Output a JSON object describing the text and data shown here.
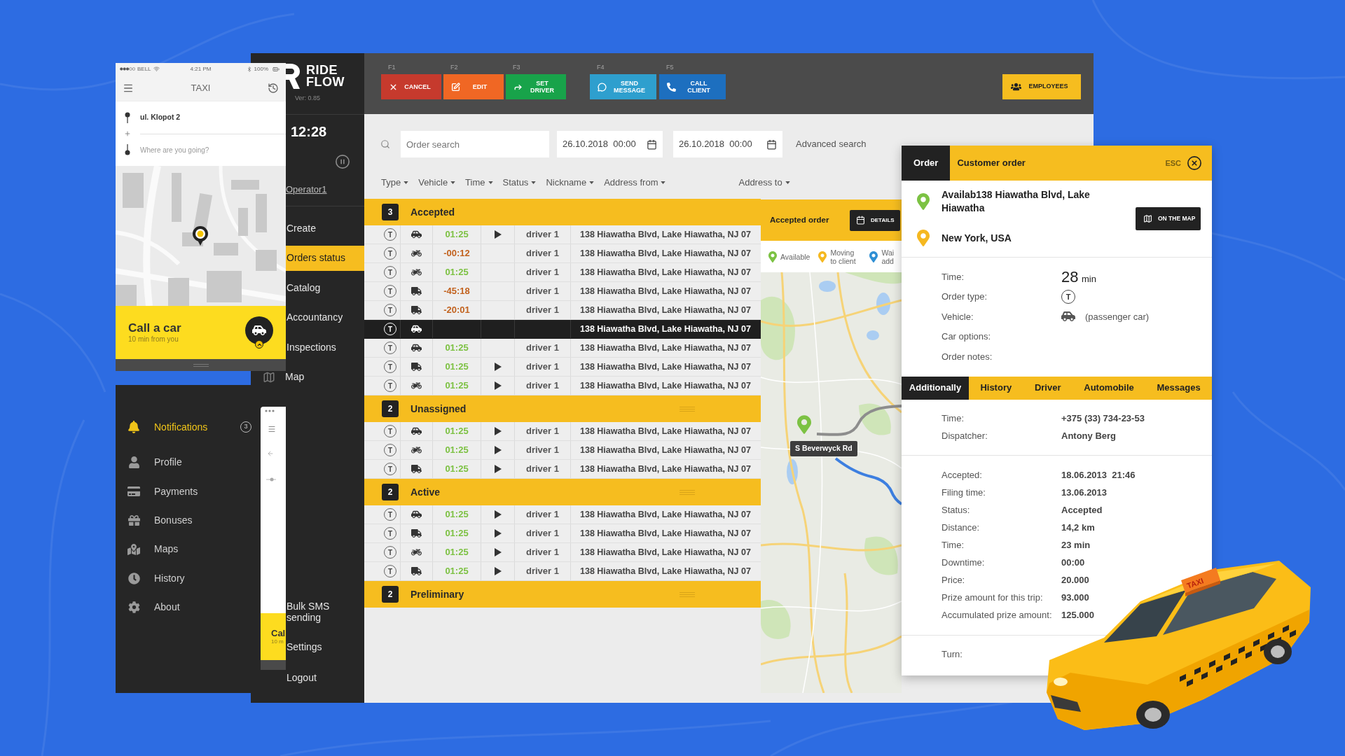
{
  "phone": {
    "status_bar": {
      "carrier": "BELL",
      "time": "4:21 PM",
      "battery": "100%"
    },
    "title": "TAXI",
    "pickup": "ul. Klopot 2",
    "destination": {
      "placeholder": "Where are you going?"
    },
    "call_panel": {
      "title": "Call a car",
      "subtitle": "10 min from you"
    }
  },
  "phone_menu": {
    "items": [
      {
        "label": "Notifications",
        "selected": true,
        "badge": "3"
      },
      {
        "label": "Profile",
        "selected": false
      },
      {
        "label": "Payments",
        "selected": false
      },
      {
        "label": "Bonuses",
        "selected": false
      },
      {
        "label": "Maps",
        "selected": false
      },
      {
        "label": "History",
        "selected": false
      },
      {
        "label": "About",
        "selected": false
      }
    ],
    "peek": {
      "title": "Cal",
      "subtitle": "10 m"
    }
  },
  "sidebar": {
    "logo": [
      "RIDE",
      "FLOW"
    ],
    "version": "Ver: 0.85",
    "clock": "12:28",
    "operator": "Operator1",
    "nav": [
      {
        "label": "Create",
        "selected": false
      },
      {
        "label": "Orders status",
        "selected": true
      },
      {
        "label": "Catalog",
        "selected": false
      },
      {
        "label": "Accountancy",
        "selected": false
      },
      {
        "label": "Inspections",
        "selected": false
      },
      {
        "label": "Map",
        "selected": false
      }
    ],
    "nav_bottom": [
      {
        "label": "Bulk SMS sending",
        "selected": false
      },
      {
        "label": "Settings",
        "selected": false
      },
      {
        "label": "Logout",
        "selected": false
      }
    ]
  },
  "toolbar": {
    "button_groups": [
      [
        {
          "key": "F1",
          "label": "CANCEL",
          "color": "#c63a2d"
        },
        {
          "key": "F2",
          "label": "EDIT",
          "color": "#f06724"
        },
        {
          "key": "F3",
          "label": "SET DRIVER",
          "color": "#18a34a"
        }
      ],
      [
        {
          "key": "F4",
          "label": "SEND MESSAGE",
          "color": "#2e9fce"
        },
        {
          "key": "F5",
          "label": "CALL CLIENT",
          "color": "#1d6fbf"
        }
      ]
    ],
    "employees": "EMPLOYEES"
  },
  "search": {
    "query": {
      "placeholder": "Order search"
    },
    "date_from": "26.10.2018  00:00",
    "date_to": "26.10.2018  00:00",
    "advanced": "Advanced search"
  },
  "filters": [
    [
      "Type",
      "Vehicle",
      "Time",
      "Status",
      "Nickname",
      "Address from"
    ],
    [
      "Address to"
    ]
  ],
  "orders": {
    "groups": [
      {
        "title": "Accepted",
        "count": "3",
        "handle": false,
        "rows": [
          {
            "type": "T",
            "kind": "car",
            "time": "01:25",
            "late": false,
            "play": true,
            "driver": "driver 1",
            "address": "138 Hiawatha Blvd, Lake Hiawatha, NJ 07",
            "selected": false
          },
          {
            "type": "T",
            "kind": "moto",
            "time": "-00:12",
            "late": true,
            "play": false,
            "driver": "driver 1",
            "address": "138 Hiawatha Blvd, Lake Hiawatha, NJ 07",
            "selected": false
          },
          {
            "type": "T",
            "kind": "moto",
            "time": "01:25",
            "late": false,
            "play": false,
            "driver": "driver 1",
            "address": "138 Hiawatha Blvd, Lake Hiawatha, NJ 07",
            "selected": false
          },
          {
            "type": "T",
            "kind": "truck",
            "time": "-45:18",
            "late": true,
            "play": false,
            "driver": "driver 1",
            "address": "138 Hiawatha Blvd, Lake Hiawatha, NJ 07",
            "selected": false
          },
          {
            "type": "T",
            "kind": "truck",
            "time": "-20:01",
            "late": true,
            "play": false,
            "driver": "driver 1",
            "address": "138 Hiawatha Blvd, Lake Hiawatha, NJ 07",
            "selected": false
          },
          {
            "type": "T",
            "kind": "car",
            "play": false,
            "address": "138 Hiawatha Blvd, Lake Hiawatha, NJ 07",
            "selected": true
          },
          {
            "type": "T",
            "kind": "car",
            "time": "01:25",
            "late": false,
            "play": false,
            "driver": "driver 1",
            "address": "138 Hiawatha Blvd, Lake Hiawatha, NJ 07",
            "selected": false
          },
          {
            "type": "T",
            "kind": "truck",
            "time": "01:25",
            "late": false,
            "play": true,
            "driver": "driver 1",
            "address": "138 Hiawatha Blvd, Lake Hiawatha, NJ 07",
            "selected": false
          },
          {
            "type": "T",
            "kind": "moto",
            "time": "01:25",
            "late": false,
            "play": true,
            "driver": "driver 1",
            "address": "138 Hiawatha Blvd, Lake Hiawatha, NJ 07",
            "selected": false
          }
        ]
      },
      {
        "title": "Unassigned",
        "count": "2",
        "handle": true,
        "rows": [
          {
            "type": "T",
            "kind": "car",
            "time": "01:25",
            "late": false,
            "play": true,
            "driver": "driver 1",
            "address": "138 Hiawatha Blvd, Lake Hiawatha, NJ 07",
            "selected": false
          },
          {
            "type": "T",
            "kind": "moto",
            "time": "01:25",
            "late": false,
            "play": true,
            "driver": "driver 1",
            "address": "138 Hiawatha Blvd, Lake Hiawatha, NJ 07",
            "selected": false
          },
          {
            "type": "T",
            "kind": "truck",
            "time": "01:25",
            "late": false,
            "play": true,
            "driver": "driver 1",
            "address": "138 Hiawatha Blvd, Lake Hiawatha, NJ 07",
            "selected": false
          }
        ]
      },
      {
        "title": "Active",
        "count": "2",
        "handle": true,
        "rows": [
          {
            "type": "T",
            "kind": "car",
            "time": "01:25",
            "late": false,
            "play": true,
            "driver": "driver 1",
            "address": "138 Hiawatha Blvd, Lake Hiawatha, NJ 07",
            "selected": false
          },
          {
            "type": "T",
            "kind": "truck",
            "time": "01:25",
            "late": false,
            "play": true,
            "driver": "driver 1",
            "address": "138 Hiawatha Blvd, Lake Hiawatha, NJ 07",
            "selected": false
          },
          {
            "type": "T",
            "kind": "moto",
            "time": "01:25",
            "late": false,
            "play": true,
            "driver": "driver 1",
            "address": "138 Hiawatha Blvd, Lake Hiawatha, NJ 07",
            "selected": false
          },
          {
            "type": "T",
            "kind": "truck",
            "time": "01:25",
            "late": false,
            "play": true,
            "driver": "driver 1",
            "address": "138 Hiawatha Blvd, Lake Hiawatha, NJ 07",
            "selected": false
          }
        ]
      },
      {
        "title": "Preliminary",
        "count": "2",
        "handle": true
      }
    ]
  },
  "map_panel": {
    "title": "Accepted order",
    "details_button": "DETAILS",
    "legend": [
      {
        "label": "Available",
        "color": "#7cc243"
      },
      {
        "label": "Moving to client",
        "color": "#f5b820"
      },
      {
        "label": "Wai add",
        "color": "#2f8fd4"
      }
    ],
    "tooltip": "S Beverwyck Rd"
  },
  "order_panel": {
    "tabs": [
      {
        "label": "Order",
        "selected": true
      },
      {
        "label": "Customer order",
        "selected": false
      }
    ],
    "esc": "ESC",
    "route": [
      {
        "address": "Availab138 Hiawatha Blvd, Lake Hiawatha",
        "color": "#7cc243"
      },
      {
        "address": "New York, USA",
        "color": "#f5b820"
      }
    ],
    "map_button": "ON THE MAP",
    "summary": [
      {
        "kind": "big",
        "label": "Time:",
        "value": "28",
        "unit": "min"
      },
      {
        "kind": "type",
        "label": "Order type:",
        "value": "T"
      },
      {
        "kind": "vehicle",
        "label": "Vehicle:",
        "value": "(passenger car)"
      },
      {
        "kind": "text",
        "label": "Car options:"
      },
      {
        "kind": "text",
        "label": "Order notes:"
      }
    ],
    "lower_tabs": [
      {
        "label": "Additionally",
        "selected": true
      },
      {
        "label": "History",
        "selected": false
      },
      {
        "label": "Driver",
        "selected": false
      },
      {
        "label": "Automobile",
        "selected": false
      },
      {
        "label": "Messages",
        "selected": false
      }
    ],
    "contact": [
      {
        "label": "Time:",
        "value": "+375 (33) 734-23-53"
      },
      {
        "label": "Dispatcher:",
        "value": "Antony Berg"
      }
    ],
    "details": [
      {
        "label": "Accepted:",
        "value": "18.06.2013  21:46"
      },
      {
        "label": "Filing time:",
        "value": "13.06.2013"
      },
      {
        "label": "Status:",
        "value": "Accepted"
      },
      {
        "label": "Distance:",
        "value": "14,2 km"
      },
      {
        "label": "Time:",
        "value": "23 min"
      },
      {
        "label": "Downtime:",
        "value": "00:00"
      },
      {
        "label": "Price:",
        "value": "20.000"
      },
      {
        "label": "Prize amount for this trip:",
        "value": "93.000"
      },
      {
        "label": "Accumulated prize amount:",
        "value": "125.000"
      }
    ],
    "turn": "Turn:"
  },
  "taxi": {
    "sign": "TAXI"
  }
}
